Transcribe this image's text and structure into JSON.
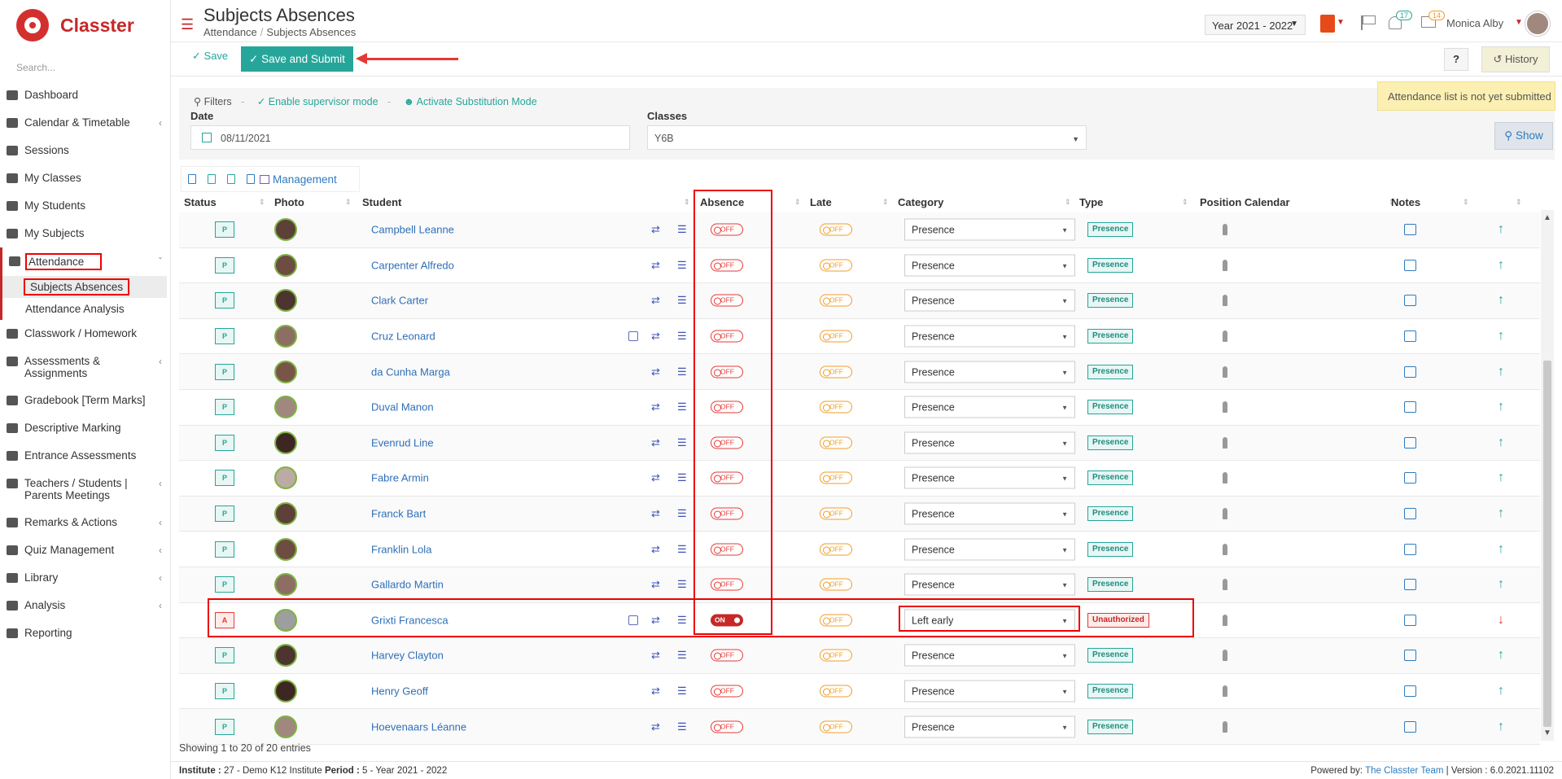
{
  "app": {
    "logo_text": "Classter"
  },
  "sidebar": {
    "search_placeholder": "Search...",
    "items": [
      {
        "label": "Dashboard",
        "icon": "laptop-icon",
        "chevron": false
      },
      {
        "label": "Calendar & Timetable",
        "icon": "calendar-icon",
        "chevron": true
      },
      {
        "label": "Sessions",
        "icon": "sessions-icon",
        "chevron": false
      },
      {
        "label": "My Classes",
        "icon": "classes-icon",
        "chevron": false
      },
      {
        "label": "My Students",
        "icon": "students-icon",
        "chevron": false
      },
      {
        "label": "My Subjects",
        "icon": "book-icon",
        "chevron": false
      },
      {
        "label": "Attendance",
        "icon": "attendance-icon",
        "chevron": true,
        "expanded": true
      }
    ],
    "attendance_sub": [
      "Subjects Absences",
      "Attendance Analysis"
    ],
    "items_after": [
      {
        "label": "Classwork / Homework",
        "icon": "list-icon",
        "chevron": false
      },
      {
        "label": "Assessments & Assignments",
        "icon": "edit-icon",
        "chevron": true
      },
      {
        "label": "Gradebook [Term Marks]",
        "icon": "gradebook-icon",
        "chevron": false
      },
      {
        "label": "Descriptive Marking",
        "icon": "check-icon",
        "chevron": false
      },
      {
        "label": "Entrance Assessments",
        "icon": "user-icon",
        "chevron": false
      },
      {
        "label": "Teachers / Students | Parents Meetings",
        "icon": "meeting-icon",
        "chevron": true
      },
      {
        "label": "Remarks & Actions",
        "icon": "remarks-icon",
        "chevron": true
      },
      {
        "label": "Quiz Management",
        "icon": "quiz-icon",
        "chevron": true
      },
      {
        "label": "Library",
        "icon": "library-icon",
        "chevron": true
      },
      {
        "label": "Analysis",
        "icon": "chart-icon",
        "chevron": true
      },
      {
        "label": "Reporting",
        "icon": "printer-icon",
        "chevron": false
      }
    ]
  },
  "header": {
    "title": "Subjects Absences",
    "breadcrumb": [
      "Attendance",
      "Subjects Absences"
    ],
    "year": "Year 2021 - 2022",
    "notifications_count": "17",
    "messages_count": "14",
    "user": "Monica Alby"
  },
  "actions": {
    "save": "Save",
    "save_submit": "Save and Submit",
    "help": "?",
    "history": "History"
  },
  "notice": "Attendance list is not yet submitted",
  "filters": {
    "label": "Filters",
    "supervisor": "Enable supervisor mode",
    "substitution": "Activate Substitution Mode",
    "date_label": "Date",
    "date_value": "08/11/2021",
    "classes_label": "Classes",
    "classes_value": "Y6B",
    "show": "Show"
  },
  "table": {
    "management": "Management",
    "columns": [
      "Status",
      "Photo",
      "Student",
      "Absence",
      "Late",
      "Category",
      "Type",
      "Position Calendar",
      "Notes"
    ],
    "rows": [
      {
        "status": "P",
        "name": "Campbell Leanne",
        "bus": false,
        "absence": "OFF",
        "late": "OFF",
        "category": "Presence",
        "type": "Presence",
        "dir": "up"
      },
      {
        "status": "P",
        "name": "Carpenter Alfredo",
        "bus": false,
        "absence": "OFF",
        "late": "OFF",
        "category": "Presence",
        "type": "Presence",
        "dir": "up"
      },
      {
        "status": "P",
        "name": "Clark Carter",
        "bus": false,
        "absence": "OFF",
        "late": "OFF",
        "category": "Presence",
        "type": "Presence",
        "dir": "up"
      },
      {
        "status": "P",
        "name": "Cruz Leonard",
        "bus": true,
        "absence": "OFF",
        "late": "OFF",
        "category": "Presence",
        "type": "Presence",
        "dir": "up"
      },
      {
        "status": "P",
        "name": "da Cunha Marga",
        "bus": false,
        "absence": "OFF",
        "late": "OFF",
        "category": "Presence",
        "type": "Presence",
        "dir": "up"
      },
      {
        "status": "P",
        "name": "Duval Manon",
        "bus": false,
        "absence": "OFF",
        "late": "OFF",
        "category": "Presence",
        "type": "Presence",
        "dir": "up"
      },
      {
        "status": "P",
        "name": "Evenrud Line",
        "bus": false,
        "absence": "OFF",
        "late": "OFF",
        "category": "Presence",
        "type": "Presence",
        "dir": "up"
      },
      {
        "status": "P",
        "name": "Fabre Armin",
        "bus": false,
        "absence": "OFF",
        "late": "OFF",
        "category": "Presence",
        "type": "Presence",
        "dir": "up"
      },
      {
        "status": "P",
        "name": "Franck Bart",
        "bus": false,
        "absence": "OFF",
        "late": "OFF",
        "category": "Presence",
        "type": "Presence",
        "dir": "up"
      },
      {
        "status": "P",
        "name": "Franklin Lola",
        "bus": false,
        "absence": "OFF",
        "late": "OFF",
        "category": "Presence",
        "type": "Presence",
        "dir": "up"
      },
      {
        "status": "P",
        "name": "Gallardo Martin",
        "bus": false,
        "absence": "OFF",
        "late": "OFF",
        "category": "Presence",
        "type": "Presence",
        "dir": "up"
      },
      {
        "status": "A",
        "name": "Grixti Francesca",
        "bus": true,
        "absence": "ON",
        "late": "OFF",
        "category": "Left early",
        "type": "Unauthorized",
        "dir": "down"
      },
      {
        "status": "P",
        "name": "Harvey Clayton",
        "bus": false,
        "absence": "OFF",
        "late": "OFF",
        "category": "Presence",
        "type": "Presence",
        "dir": "up"
      },
      {
        "status": "P",
        "name": "Henry Geoff",
        "bus": false,
        "absence": "OFF",
        "late": "OFF",
        "category": "Presence",
        "type": "Presence",
        "dir": "up"
      },
      {
        "status": "P",
        "name": "Hoevenaars Léanne",
        "bus": false,
        "absence": "OFF",
        "late": "OFF",
        "category": "Presence",
        "type": "Presence",
        "dir": "up"
      }
    ],
    "showing": "Showing 1 to 20 of 20 entries"
  },
  "footer": {
    "institute_label": "Institute :",
    "institute_value": "27 - Demo K12 Institute",
    "period_label": "Period :",
    "period_value": "5 - Year 2021 - 2022",
    "powered": "Powered by:",
    "team": "The Classter Team",
    "version": "| Version : 6.0.2021.11102"
  }
}
